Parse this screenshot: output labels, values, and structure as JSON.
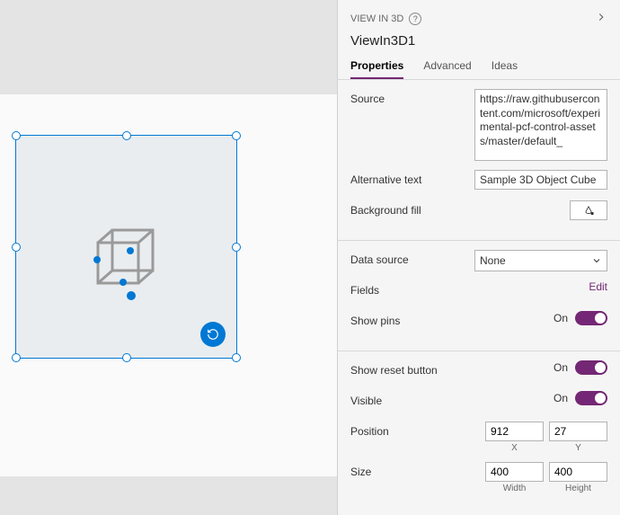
{
  "componentType": "VIEW IN 3D",
  "componentName": "ViewIn3D1",
  "tabs": {
    "properties": "Properties",
    "advanced": "Advanced",
    "ideas": "Ideas"
  },
  "props": {
    "labels": {
      "source": "Source",
      "altText": "Alternative text",
      "bgFill": "Background fill",
      "dataSource": "Data source",
      "fields": "Fields",
      "showPins": "Show pins",
      "showReset": "Show reset button",
      "visible": "Visible",
      "position": "Position",
      "size": "Size"
    },
    "values": {
      "source": "https://raw.githubusercontent.com/microsoft/experimental-pcf-control-assets/master/default_",
      "altText": "Sample 3D Object Cube",
      "dataSource": "None",
      "fieldsAction": "Edit",
      "showPins": "On",
      "showReset": "On",
      "visible": "On",
      "positionX": "912",
      "positionY": "27",
      "sizeW": "400",
      "sizeH": "400"
    },
    "sublabels": {
      "x": "X",
      "y": "Y",
      "w": "Width",
      "h": "Height"
    }
  }
}
